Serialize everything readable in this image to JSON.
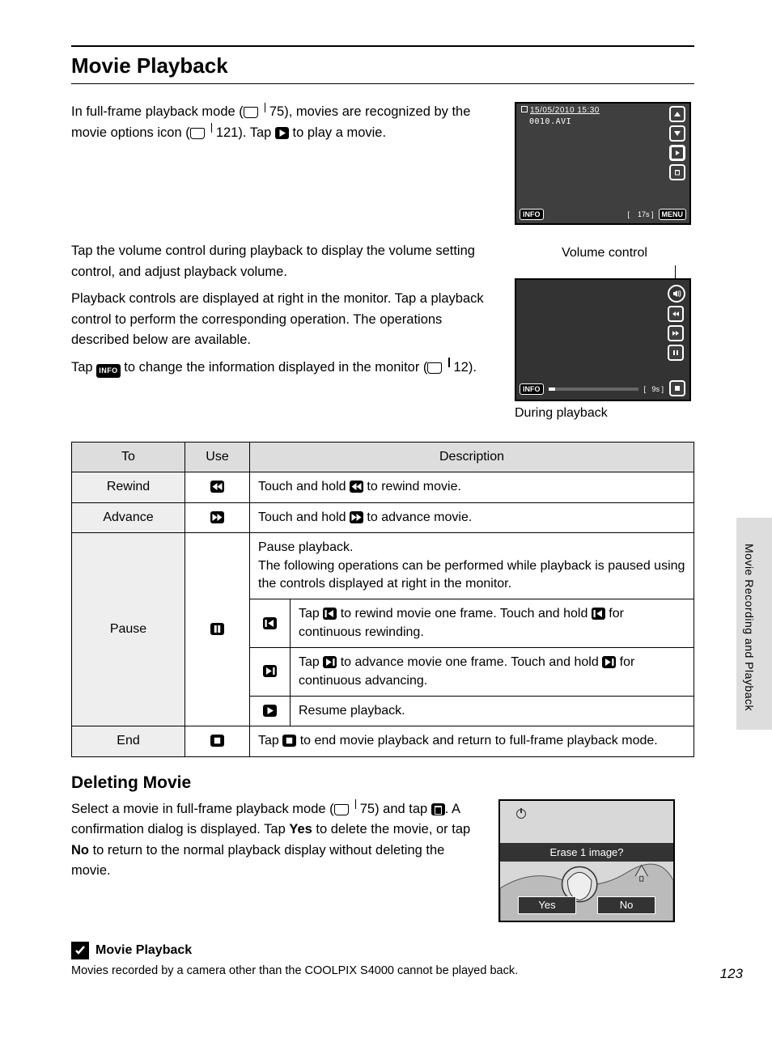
{
  "title": "Movie Playback",
  "intro": {
    "p1a": "In full-frame playback mode (",
    "p1b": " 75), movies are recognized by the movie options icon (",
    "p1c": " 121). Tap ",
    "p1d": " to play a movie."
  },
  "lcd1": {
    "date": "15/05/2010  15:30",
    "file": "0010.AVI",
    "time": "17s",
    "info": "INFO",
    "menu": "MENU"
  },
  "mid": {
    "p1": "Tap the volume control during playback to display the volume setting control, and adjust playback volume.",
    "p2": "Playback controls are displayed at right in the monitor. Tap a playback control to perform the corresponding operation. The operations described below are available.",
    "p3a": "Tap ",
    "p3b": " to change the information displayed in the monitor (",
    "p3c": " 12)."
  },
  "fig2": {
    "cap_top": "Volume control",
    "cap_bottom": "During playback",
    "time": "9s",
    "info": "INFO"
  },
  "table": {
    "h1": "To",
    "h2": "Use",
    "h3": "Description",
    "rows": {
      "rewind_lbl": "Rewind",
      "rewind_desc_a": "Touch and hold ",
      "rewind_desc_b": " to rewind movie.",
      "advance_lbl": "Advance",
      "advance_desc_a": "Touch and hold ",
      "advance_desc_b": " to advance movie.",
      "pause_lbl": "Pause",
      "pause_intro": "Pause playback.\nThe following operations can be performed while playback is paused using the controls displayed at right in the monitor.",
      "pause_r1a": "Tap ",
      "pause_r1b": " to rewind movie one frame. Touch and hold ",
      "pause_r1c": " for continuous rewinding.",
      "pause_r2a": "Tap ",
      "pause_r2b": " to advance movie one frame. Touch and hold ",
      "pause_r2c": " for continuous advancing.",
      "pause_r3": "Resume playback.",
      "end_lbl": "End",
      "end_desc_a": "Tap ",
      "end_desc_b": " to end movie playback and return to full-frame playback mode."
    }
  },
  "deleting": {
    "h": "Deleting Movie",
    "p_a": "Select a movie in full-frame playback mode (",
    "p_b": " 75) and tap ",
    "p_c": ". A confirmation dialog is displayed. Tap ",
    "yes": "Yes",
    "p_d": " to delete the movie, or tap ",
    "no": "No",
    "p_e": " to return to the normal playback display without deleting the movie.",
    "dialog": "Erase 1 image?",
    "btn_yes": "Yes",
    "btn_no": "No"
  },
  "note": {
    "h": "Movie Playback",
    "t": "Movies recorded by a camera other than the COOLPIX S4000 cannot be played back."
  },
  "sidetab": "Movie Recording and Playback",
  "pagenum": "123",
  "info_label": "INFO"
}
